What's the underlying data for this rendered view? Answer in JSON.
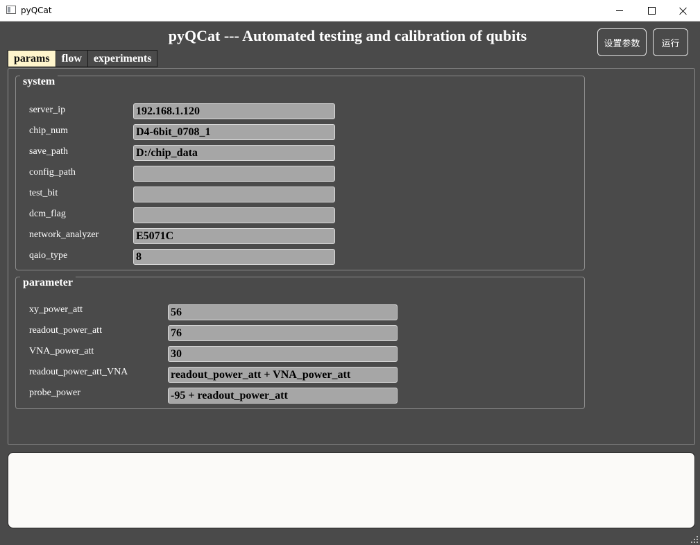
{
  "window": {
    "title": "pyQCat"
  },
  "header": {
    "title": "pyQCat --- Automated testing and calibration of qubits"
  },
  "buttons": {
    "settings_label": "设置参数",
    "run_label": "运行"
  },
  "tabs": [
    {
      "label": "params",
      "active": true
    },
    {
      "label": "flow",
      "active": false
    },
    {
      "label": "experiments",
      "active": false
    }
  ],
  "system": {
    "title": "system",
    "fields": [
      {
        "label": "server_ip",
        "value": "192.168.1.120"
      },
      {
        "label": "chip_num",
        "value": "D4-6bit_0708_1"
      },
      {
        "label": "save_path",
        "value": "D:/chip_data"
      },
      {
        "label": "config_path",
        "value": ""
      },
      {
        "label": "test_bit",
        "value": ""
      },
      {
        "label": "dcm_flag",
        "value": ""
      },
      {
        "label": "network_analyzer",
        "value": "E5071C"
      },
      {
        "label": "qaio_type",
        "value": "8"
      }
    ]
  },
  "parameter": {
    "title": "parameter",
    "fields": [
      {
        "label": "xy_power_att",
        "value": "56"
      },
      {
        "label": "readout_power_att",
        "value": "76"
      },
      {
        "label": "VNA_power_att",
        "value": "30"
      },
      {
        "label": "readout_power_att_VNA",
        "value": "readout_power_att + VNA_power_att"
      },
      {
        "label": "probe_power",
        "value": "-95 + readout_power_att"
      }
    ]
  },
  "log": {
    "text": ""
  }
}
